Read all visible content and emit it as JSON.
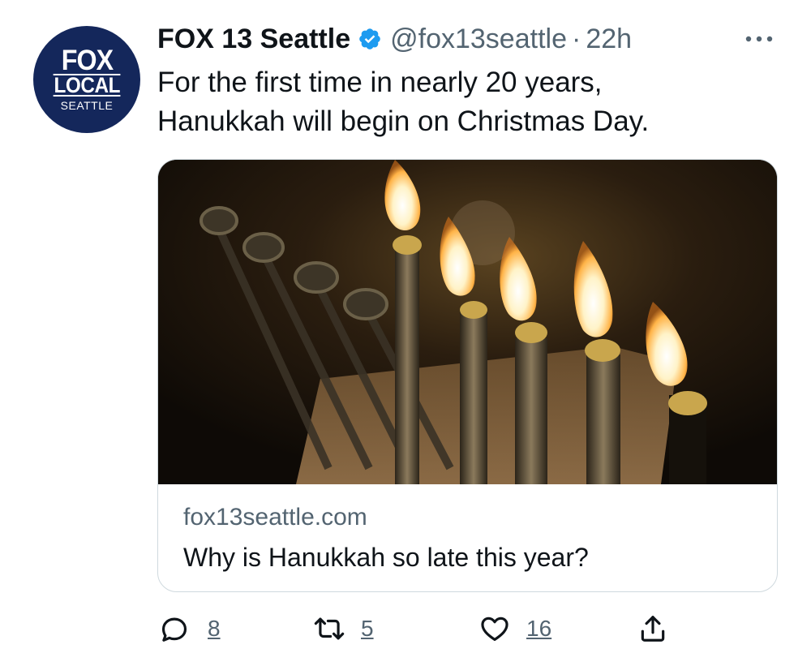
{
  "author": {
    "display_name": "FOX 13 Seattle",
    "handle": "@fox13seattle",
    "separator": "·",
    "time": "22h",
    "avatar": {
      "line1": "FOX",
      "line2": "LOCAL",
      "line3": "SEATTLE",
      "background": "#14275b"
    },
    "verified_color": "#1d9bf0"
  },
  "tweet": {
    "text_line1": "For the first time in nearly 20 years,",
    "text_line2": "Hanukkah will begin on Christmas Day."
  },
  "card": {
    "image_icon": "menorah-photo",
    "domain": "fox13seattle.com",
    "title": "Why is Hanukkah so late this year?"
  },
  "actions": {
    "reply_count": "8",
    "retweet_count": "5",
    "like_count": "16",
    "icons": [
      "reply-icon",
      "retweet-icon",
      "like-icon",
      "share-icon"
    ]
  },
  "colors": {
    "text_primary": "#0f1419",
    "text_secondary": "#536471",
    "border": "#cfd9de"
  }
}
